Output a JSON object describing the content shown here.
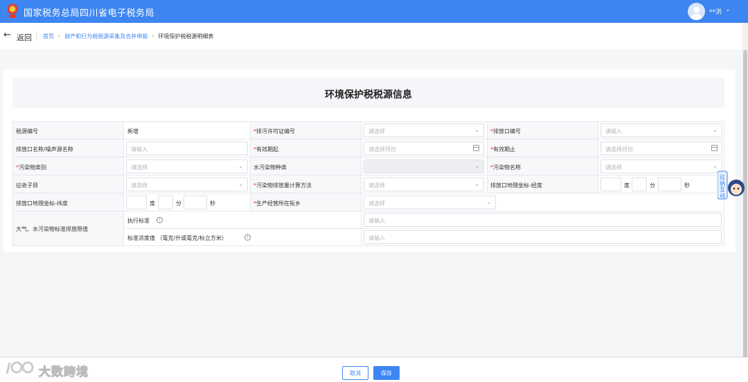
{
  "header": {
    "title": "国家税务总局四川省电子税务局",
    "username": "**洪",
    "colors": {
      "primary": "#3d86f1"
    }
  },
  "nav": {
    "back_label": "返回",
    "breadcrumb": [
      "首页",
      "财产和行为税税源采集及合并申报",
      "环境保护税税源明细表"
    ]
  },
  "form": {
    "title": "环境保护税税源信息",
    "rows": [
      {
        "label": "税源编号",
        "value": "新增",
        "mid_label": "排污许可证编号",
        "mid_required": true,
        "mid_placeholder": "请选择",
        "right_label": "排放口编号",
        "right_required": true,
        "right_placeholder": "请输入"
      },
      {
        "label": "排放口名称/噪声源名称",
        "placeholder": "请输入",
        "mid_label": "有效期起",
        "mid_required": true,
        "mid_placeholder": "请选择月份",
        "right_label": "有效期止",
        "right_required": true,
        "right_placeholder": "请选择月份"
      },
      {
        "label": "污染物类别",
        "required": true,
        "placeholder": "请选择",
        "mid_label": "水污染物种类",
        "mid_placeholder": "",
        "right_label": "污染物名称",
        "right_required": true,
        "right_placeholder": "请选择"
      },
      {
        "label": "征收子目",
        "placeholder": "请选择",
        "mid_label": "污染物排放量计算方法",
        "mid_required": true,
        "mid_placeholder": "请选择",
        "right_label": "排放口地理坐标-经度"
      },
      {
        "label": "排放口地理坐标-纬度",
        "mid_label": "生产经营所在街乡",
        "mid_required": true,
        "mid_placeholder": "请选择"
      }
    ],
    "coord_units": {
      "degree": "度",
      "minute": "分",
      "second": "秒"
    },
    "limit_section": {
      "label": "大气、水污染物标准排放限值",
      "standard_label": "执行标准",
      "standard_placeholder": "请输入",
      "concentration_label": "标准浓度值 （毫克/升或毫克/标立方米）",
      "concentration_placeholder": "请输入"
    }
  },
  "footer": {
    "cancel_label": "取消",
    "save_label": "保存"
  },
  "watermark": {
    "text": "大数跨境"
  },
  "mascot": {
    "text": "征纳互动"
  },
  "icons": {
    "back": "arrow-left-icon",
    "chevron": "chevron-down-icon",
    "calendar": "calendar-icon",
    "info": "info-icon"
  }
}
